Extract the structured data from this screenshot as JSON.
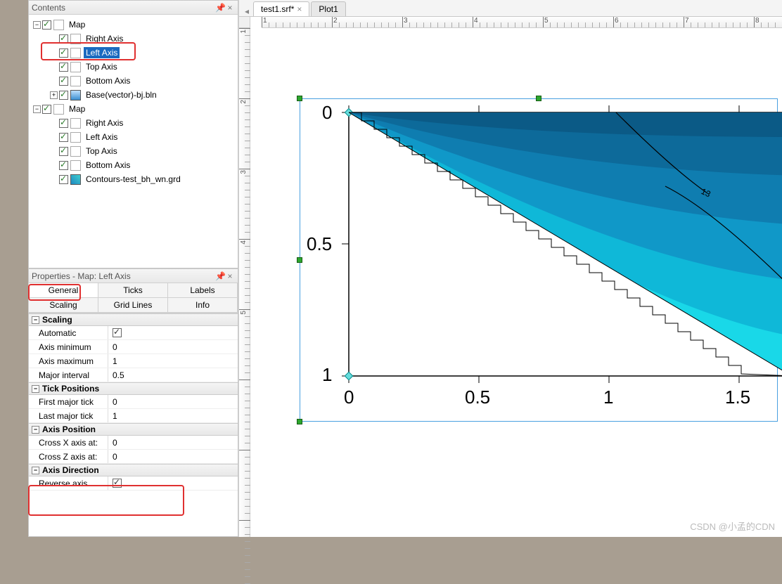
{
  "panels": {
    "contents_title": "Contents",
    "properties_title": "Properties - Map: Left Axis"
  },
  "tree": {
    "map1": {
      "label": "Map",
      "right": "Right Axis",
      "left": "Left Axis",
      "top": "Top Axis",
      "bottom": "Bottom Axis",
      "base": "Base(vector)-bj.bln"
    },
    "map2": {
      "label": "Map",
      "right": "Right Axis",
      "left": "Left Axis",
      "top": "Top Axis",
      "bottom": "Bottom Axis",
      "cont": "Contours-test_bh_wn.grd"
    }
  },
  "tabs": {
    "general": "General",
    "ticks": "Ticks",
    "labels": "Labels",
    "scaling": "Scaling",
    "gridlines": "Grid Lines",
    "info": "Info"
  },
  "groups": {
    "scaling": "Scaling",
    "tickpos": "Tick Positions",
    "axispos": "Axis Position",
    "axisdir": "Axis Direction"
  },
  "props": {
    "automatic": {
      "n": "Automatic"
    },
    "axis_min": {
      "n": "Axis minimum",
      "v": "0"
    },
    "axis_max": {
      "n": "Axis maximum",
      "v": "1"
    },
    "major_int": {
      "n": "Major interval",
      "v": "0.5"
    },
    "first_tick": {
      "n": "First major tick",
      "v": "0"
    },
    "last_tick": {
      "n": "Last major tick",
      "v": "1"
    },
    "cross_x": {
      "n": "Cross X axis at:",
      "v": "0"
    },
    "cross_z": {
      "n": "Cross Z axis at:",
      "v": "0"
    },
    "reverse": {
      "n": "Reverse axis"
    }
  },
  "docs": {
    "tab1": "test1.srf*",
    "tab2": "Plot1"
  },
  "chart_data": {
    "type": "area",
    "xlabel": "",
    "ylabel": "",
    "xticks": [
      "0",
      "0.5",
      "1",
      "1.5"
    ],
    "yticks": [
      "0",
      "0.5",
      "1"
    ],
    "xlim": [
      0,
      1.7
    ],
    "ylim_reversed": [
      0,
      1
    ],
    "annotations": [
      {
        "text": "13",
        "x": 1.55,
        "y": 0.38
      }
    ],
    "contour_label": "13"
  },
  "ruler": {
    "h": [
      "1",
      "2",
      "3",
      "4",
      "5",
      "6",
      "7",
      "8"
    ],
    "v": [
      "1",
      "2",
      "3",
      "4",
      "5"
    ]
  },
  "watermark": "CSDN @小孟的CDN"
}
